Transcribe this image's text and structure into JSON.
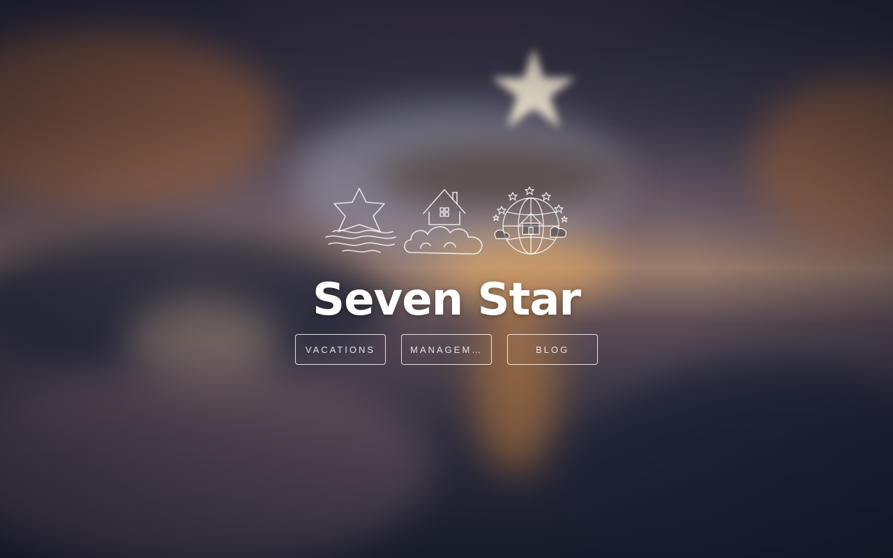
{
  "site": {
    "title": "Seven Star"
  },
  "logo": {
    "icons": [
      "star-over-waves-icon",
      "house-on-cloud-icon",
      "globe-with-stars-icon"
    ]
  },
  "nav": {
    "items": [
      {
        "label": "Vacations"
      },
      {
        "label": "Management"
      },
      {
        "label": "Blog"
      }
    ]
  },
  "colors": {
    "text": "#ffffff",
    "button_border": "#ffffff",
    "background_dark": "#1c2131",
    "sunset_orange": "#e08a3c"
  }
}
